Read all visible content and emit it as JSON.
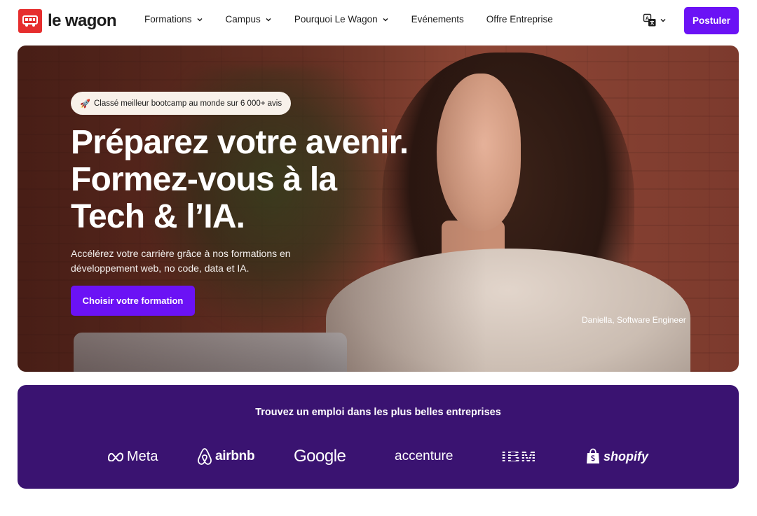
{
  "brand": {
    "name": "le wagon",
    "accent": "#6b12f5",
    "logo_red": "#e62e2e"
  },
  "nav": {
    "items": [
      {
        "label": "Formations",
        "has_dropdown": true
      },
      {
        "label": "Campus",
        "has_dropdown": true
      },
      {
        "label": "Pourquoi Le Wagon",
        "has_dropdown": true
      },
      {
        "label": "Evénements",
        "has_dropdown": false
      },
      {
        "label": "Offre Entreprise",
        "has_dropdown": false
      }
    ],
    "language_icon": "translate-icon",
    "apply_label": "Postuler"
  },
  "hero": {
    "badge": "Classé meilleur bootcamp au monde sur 6 000+ avis",
    "badge_icon": "rocket-icon",
    "headline_lines": [
      "Préparez votre avenir.",
      "Formez-vous à la",
      "Tech & l’IA."
    ],
    "subtitle": "Accélérez votre carrière grâce à nos formations en développement web, no code, data et IA.",
    "cta_label": "Choisir votre formation",
    "caption": "Daniella, Software Engineer"
  },
  "companies": {
    "title": "Trouvez un emploi dans les plus belles entreprises",
    "background": "#3a1371",
    "logos": [
      "Meta",
      "airbnb",
      "Google",
      "accenture",
      "IBM",
      "shopify"
    ]
  }
}
